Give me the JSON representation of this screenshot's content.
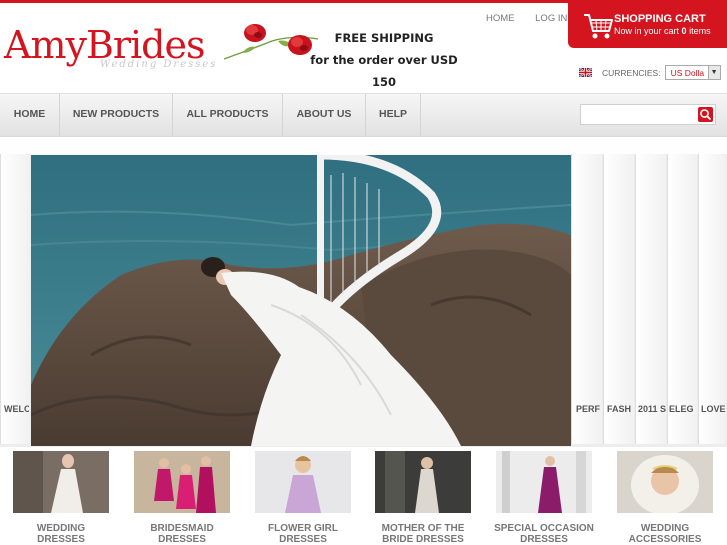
{
  "brand": {
    "name": "AmyBrides",
    "tagline": "Wedding Dresses"
  },
  "promo": {
    "line1": "FREE SHIPPING",
    "line2": "for the order over USD 150"
  },
  "top_links": {
    "home": "HOME",
    "login": "LOG IN"
  },
  "cart": {
    "title": "SHOPPING CART",
    "prefix": "Now in your cart",
    "count": "0",
    "suffix": "items"
  },
  "currency": {
    "label": "CURRENCIES:",
    "selected": "US Dolla",
    "flag_icon": "uk-flag-icon"
  },
  "nav": {
    "items": [
      {
        "label": "HOME"
      },
      {
        "label": "NEW PRODUCTS"
      },
      {
        "label": "ALL PRODUCTS"
      },
      {
        "label": "ABOUT US"
      },
      {
        "label": "HELP"
      }
    ],
    "search_placeholder": "",
    "search_icon": "search-icon"
  },
  "slider": {
    "labels": [
      "WELCO",
      "PERF",
      "FASH",
      "2011 S",
      "ELEG",
      "LOVE"
    ]
  },
  "categories": [
    {
      "line1": "WEDDING",
      "line2": "DRESSES"
    },
    {
      "line1": "BRIDESMAID",
      "line2": "DRESSES"
    },
    {
      "line1": "FLOWER GIRL",
      "line2": "DRESSES"
    },
    {
      "line1": "MOTHER OF THE",
      "line2": "BRIDE DRESSES"
    },
    {
      "line1": "SPECIAL OCCASION",
      "line2": "DRESSES"
    },
    {
      "line1": "WEDDING",
      "line2": "ACCESSORIES"
    }
  ],
  "colors": {
    "brand_red": "#d4141f",
    "nav_text": "#555555",
    "category_text": "#777777"
  }
}
